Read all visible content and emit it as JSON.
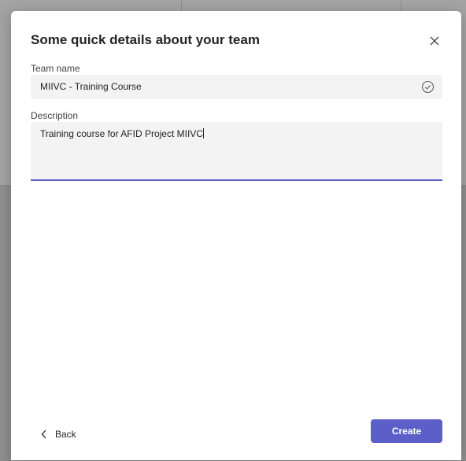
{
  "dialog": {
    "title": "Some quick details about your team",
    "team_name_label": "Team name",
    "team_name_value": "MIIVC - Training Course",
    "description_label": "Description",
    "description_value": "Training course for AFID Project MIIVC",
    "back_label": "Back",
    "create_label": "Create",
    "accent_color": "#5b5fc7"
  },
  "icons": {
    "close": "close-icon",
    "valid": "checkmark-circle-icon",
    "back": "chevron-left-icon"
  }
}
